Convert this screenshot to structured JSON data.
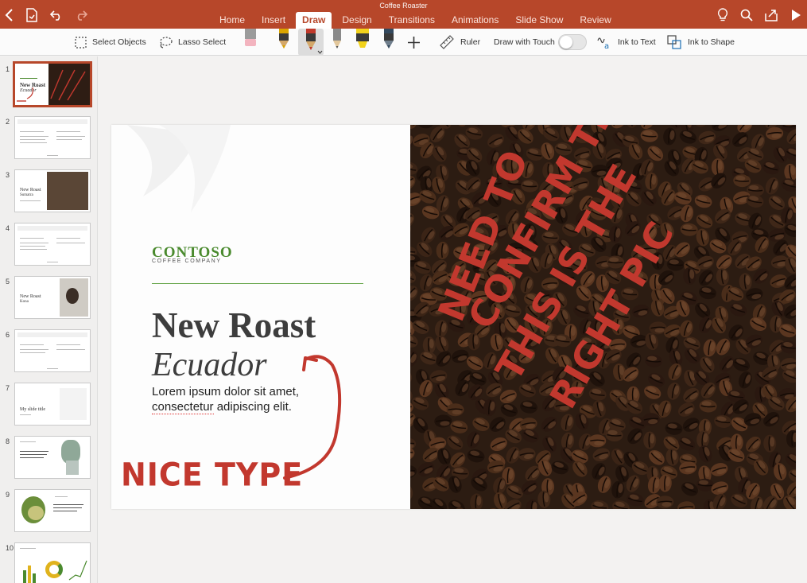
{
  "app": {
    "document_title": "Coffee Roaster",
    "tabs": [
      "Home",
      "Insert",
      "Draw",
      "Design",
      "Transitions",
      "Animations",
      "Slide Show",
      "Review"
    ],
    "active_tab": "Draw"
  },
  "ribbon": {
    "select_objects": "Select Objects",
    "lasso_select": "Lasso Select",
    "ruler": "Ruler",
    "draw_with_touch": "Draw with Touch",
    "draw_with_touch_on": false,
    "ink_to_text": "Ink to Text",
    "ink_to_shape": "Ink to Shape",
    "pen_colors": [
      "#d9a400",
      "#c0392b",
      "#8a8a8a",
      "#f2d21b",
      "#34495e"
    ]
  },
  "thumbnails": {
    "numbers": [
      "1",
      "2",
      "3",
      "4",
      "5",
      "6",
      "7",
      "8",
      "9",
      "10"
    ],
    "selected": 1,
    "slide7_title": "My slide title"
  },
  "slide": {
    "brand": "CONTOSO",
    "brand_sub": "COFFEE COMPANY",
    "title_line1": "New Roast",
    "title_line2": "Ecuador",
    "body_line1": "Lorem ipsum dolor sit amet,",
    "body_line2_word1": "consectetur",
    "body_line2_rest": " adipiscing elit.",
    "ink_note_left": "NICE TYPE",
    "ink_note_right": [
      "NEED TO",
      "CONFIRM THAT",
      "THIS IS THE",
      "RIGHT PIC"
    ]
  },
  "colors": {
    "accent": "#b7472a",
    "brand_green": "#4a8a2e",
    "ink": "#c2382e"
  }
}
